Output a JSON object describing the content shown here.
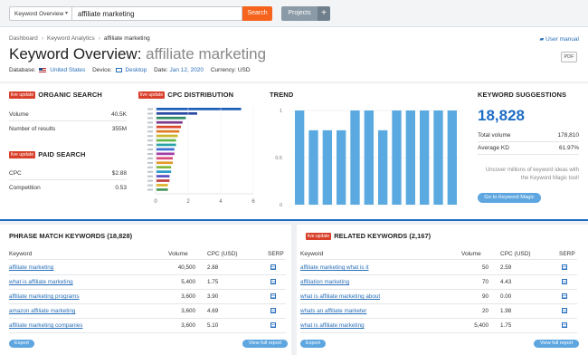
{
  "search": {
    "database_label": "Keyword Overview",
    "query": "affiliate marketing",
    "search_button": "Search",
    "projects_button": "Projects",
    "plus_button": "+"
  },
  "breadcrumb": [
    "Dashboard",
    "Keyword Analytics",
    "affiliate marketing"
  ],
  "user_manual": "User manual",
  "title": {
    "prefix": "Keyword Overview:",
    "keyword": "affiliate marketing"
  },
  "pdf_button": "PDF",
  "filters": {
    "database_label": "Database:",
    "database_value": "United States",
    "device_label": "Device:",
    "device_value": "Desktop",
    "date_label": "Date:",
    "date_value": "Jan 12, 2020",
    "currency_label": "Currency:",
    "currency_value": "USD"
  },
  "badge": "live update",
  "organic": {
    "title": "ORGANIC SEARCH",
    "rows": [
      {
        "label": "Volume",
        "value": "40.5K"
      },
      {
        "label": "Number of results",
        "value": "355M"
      }
    ]
  },
  "paid": {
    "title": "PAID SEARCH",
    "rows": [
      {
        "label": "CPC",
        "value": "$2.88"
      },
      {
        "label": "Competition",
        "value": "0.53"
      }
    ]
  },
  "cpc_title": "CPC DISTRIBUTION",
  "trend_title": "TREND",
  "suggestions": {
    "title": "KEYWORD SUGGESTIONS",
    "count": "18,828",
    "rows": [
      {
        "label": "Total volume",
        "value": "178,810"
      },
      {
        "label": "Average KD",
        "value": "61.97%"
      }
    ],
    "promo": "Uncover millions of keyword ideas with the Keyword Magic tool!",
    "button": "Go to Keyword Magic"
  },
  "chart_data": [
    {
      "type": "bar",
      "orientation": "horizontal",
      "xlim": [
        0,
        6
      ],
      "x_ticks": [
        "0",
        "2",
        "4",
        "6"
      ],
      "values": [
        5.2,
        2.5,
        1.8,
        1.6,
        1.5,
        1.4,
        1.3,
        1.2,
        1.2,
        1.1,
        1.1,
        1.0,
        1.0,
        0.9,
        0.9,
        0.8,
        0.8,
        0.7,
        0.7
      ],
      "colors": [
        "#1e5fb8",
        "#2b4aa0",
        "#2f8a66",
        "#7c3a8c",
        "#d94a2b",
        "#e07b22",
        "#c9b62a",
        "#67b64a",
        "#2aa3a8",
        "#3d6fd1",
        "#a23fa6",
        "#d94a7b",
        "#e39a2c",
        "#7fb83a",
        "#2d9bc9",
        "#5a4fc2",
        "#c23f3f",
        "#e0b22d",
        "#4a9a5a"
      ]
    },
    {
      "type": "bar",
      "y_ticks": [
        "1",
        "0.5",
        "0"
      ],
      "ylim": [
        0,
        1
      ],
      "values": [
        1,
        0.79,
        0.79,
        0.79,
        1,
        1,
        0.79,
        1,
        1,
        1,
        1,
        1
      ]
    }
  ],
  "phrase": {
    "title": "PHRASE MATCH KEYWORDS (18,828)",
    "headers": [
      "Keyword",
      "Volume",
      "CPC (USD)",
      "SERP"
    ],
    "rows": [
      {
        "keyword": "affiliate marketing",
        "volume": "40,500",
        "cpc": "2.88"
      },
      {
        "keyword": "what is affiliate marketing",
        "volume": "5,400",
        "cpc": "1.75"
      },
      {
        "keyword": "affiliate marketing programs",
        "volume": "3,600",
        "cpc": "3.90"
      },
      {
        "keyword": "amazon affiliate marketing",
        "volume": "3,600",
        "cpc": "4.69"
      },
      {
        "keyword": "affiliate marketing companies",
        "volume": "3,600",
        "cpc": "5.10"
      }
    ],
    "export": "Export",
    "view_full": "View full report"
  },
  "related": {
    "title": "RELATED KEYWORDS (2,167)",
    "headers": [
      "Keyword",
      "Volume",
      "CPC (USD)",
      "SERP"
    ],
    "rows": [
      {
        "keyword": "affiliate marketing what is it",
        "volume": "50",
        "cpc": "2.59"
      },
      {
        "keyword": "affiliation marketing",
        "volume": "70",
        "cpc": "4.43"
      },
      {
        "keyword": "what is affiliate marketing about",
        "volume": "90",
        "cpc": "0.00"
      },
      {
        "keyword": "whats an affiliate marketer",
        "volume": "20",
        "cpc": "1.98"
      },
      {
        "keyword": "what is affiliate marketing",
        "volume": "5,400",
        "cpc": "1.75"
      }
    ],
    "export": "Export",
    "view_full": "View full report"
  }
}
